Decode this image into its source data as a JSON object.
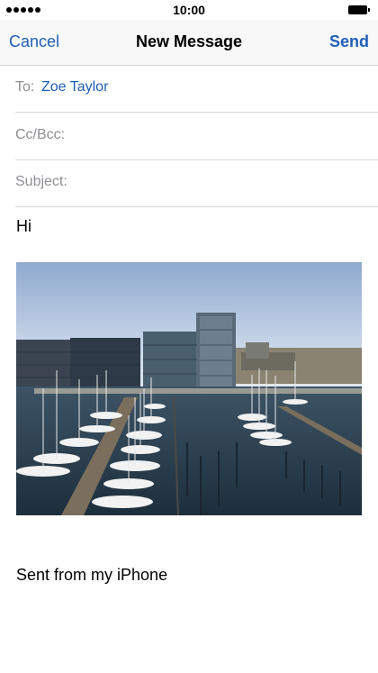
{
  "status_bar": {
    "time": "10:00",
    "signal_icon": "signal-dots-icon",
    "battery_icon": "battery-icon"
  },
  "nav": {
    "cancel_label": "Cancel",
    "title": "New Message",
    "send_label": "Send",
    "accent_color": "#1f5eb5"
  },
  "compose": {
    "to_label": "To:",
    "to_value": "Zoe Taylor",
    "cc_label": "Cc/Bcc:",
    "subject_label": "Subject:",
    "body": "Hi",
    "signature": "Sent from my iPhone"
  },
  "attachment": {
    "type": "photo"
  }
}
